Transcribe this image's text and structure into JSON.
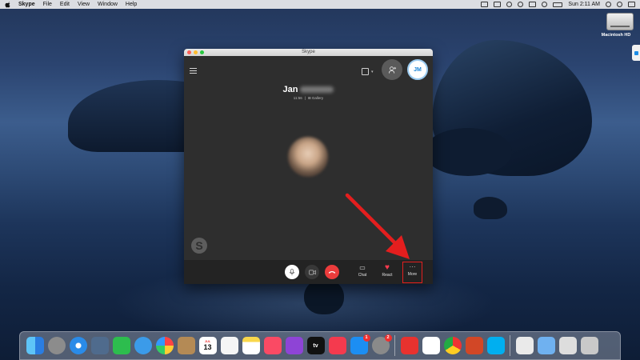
{
  "menubar": {
    "app_name": "Skype",
    "menus": [
      "File",
      "Edit",
      "View",
      "Window",
      "Help"
    ],
    "clock": "Sun 2:11 AM"
  },
  "desktop": {
    "drive_label": "Macintosh HD"
  },
  "skype": {
    "window_title": "Skype",
    "self_initials": "JM",
    "caller_first_name": "Jan",
    "call_duration": "11:56",
    "call_separator": "|",
    "gallery_label": "⊞ Gallery",
    "controls": {
      "chat_label": "Chat",
      "react_label": "React",
      "more_label": "More"
    },
    "watermark_letter": "S"
  },
  "dock": {
    "calendar_month": "JUL",
    "calendar_day": "13",
    "appstore_badge": "1",
    "settings_badge": "2",
    "appletv_label": "tv"
  },
  "colors": {
    "skype_blue": "#1a84d6",
    "hangup_red": "#ec3c3c",
    "annotation_red": "#e41e1e"
  }
}
